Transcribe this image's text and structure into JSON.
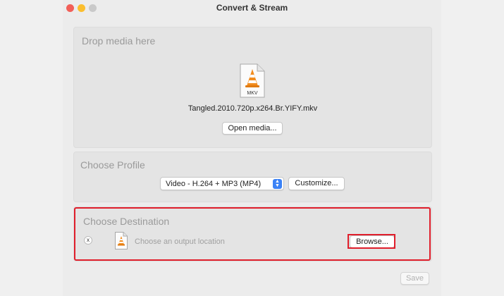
{
  "window": {
    "title": "Convert & Stream"
  },
  "drop_panel": {
    "title": "Drop media here",
    "file_icon_label": "MKV",
    "file_name": "Tangled.2010.720p.x264.Br.YIFY.mkv",
    "open_button": "Open media..."
  },
  "profile_panel": {
    "title": "Choose Profile",
    "selected_profile": "Video - H.264 + MP3 (MP4)",
    "customize_button": "Customize..."
  },
  "destination_panel": {
    "title": "Choose Destination",
    "clear_symbol": "x",
    "placeholder": "Choose an output location",
    "browse_button": "Browse..."
  },
  "footer": {
    "save_button": "Save"
  },
  "colors": {
    "highlight": "#e01e2b",
    "vlc_orange": "#f28c1e"
  }
}
